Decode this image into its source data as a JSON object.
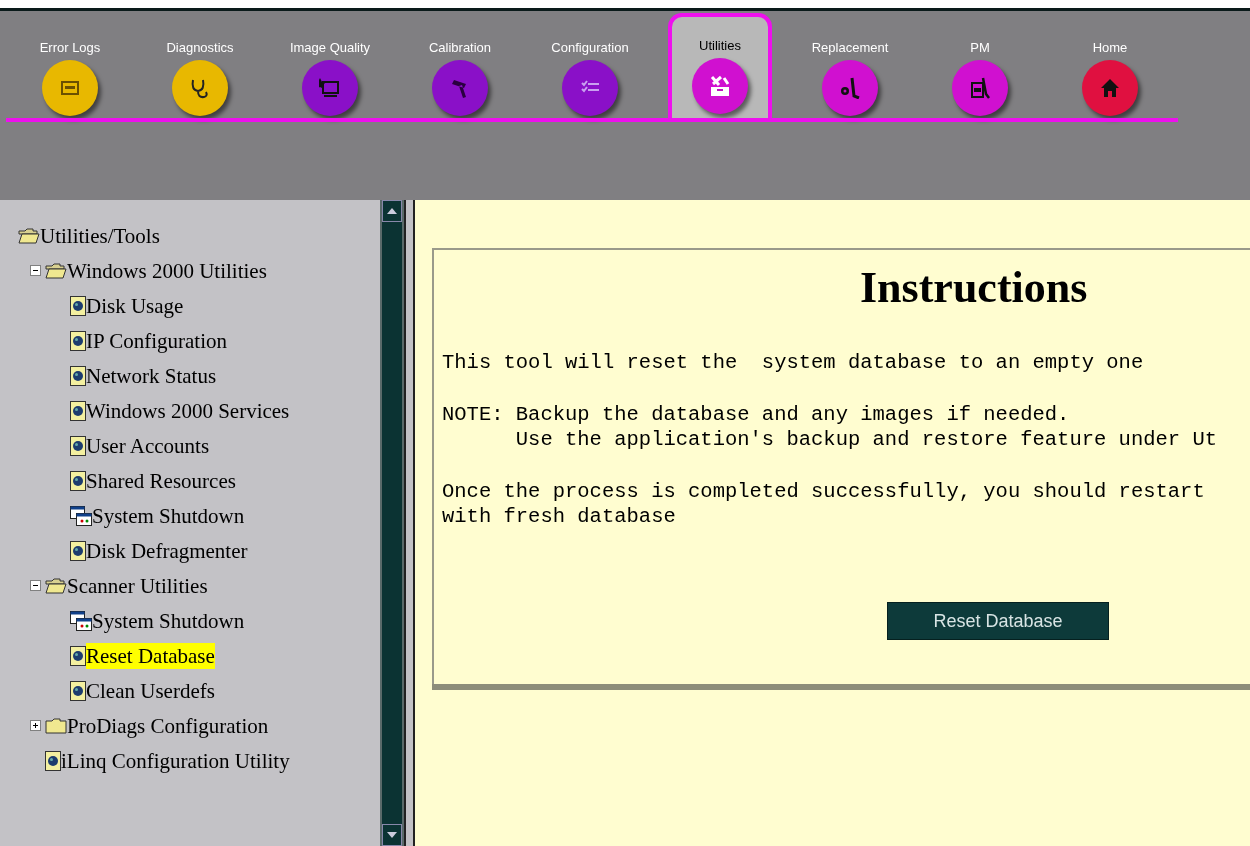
{
  "toolbar": {
    "tabs": [
      {
        "label": "Error Logs",
        "selected": false,
        "color": "#e8b800"
      },
      {
        "label": "Diagnostics",
        "selected": false,
        "color": "#e8b800"
      },
      {
        "label": "Image Quality",
        "selected": false,
        "color": "#8a10c8"
      },
      {
        "label": "Calibration",
        "selected": false,
        "color": "#8a10c8"
      },
      {
        "label": "Configuration",
        "selected": false,
        "color": "#8a10c8"
      },
      {
        "label": "Utilities",
        "selected": true,
        "color": "#d010d0"
      },
      {
        "label": "Replacement",
        "selected": false,
        "color": "#d010d0"
      },
      {
        "label": "PM",
        "selected": false,
        "color": "#d010d0"
      },
      {
        "label": "Home",
        "selected": false,
        "color": "#e01040"
      }
    ]
  },
  "tree": [
    {
      "label": "Utilities/Tools",
      "kind": "folder",
      "expanded": true,
      "selected": false,
      "children": [
        {
          "label": "Windows 2000 Utilities",
          "kind": "folder",
          "expanded": true,
          "selected": false,
          "children": [
            {
              "label": "Disk Usage",
              "kind": "page",
              "selected": false
            },
            {
              "label": "IP Configuration",
              "kind": "page",
              "selected": false
            },
            {
              "label": "Network Status",
              "kind": "page",
              "selected": false
            },
            {
              "label": "Windows 2000 Services",
              "kind": "page",
              "selected": false
            },
            {
              "label": "User Accounts",
              "kind": "page",
              "selected": false
            },
            {
              "label": "Shared Resources",
              "kind": "page",
              "selected": false
            },
            {
              "label": "System Shutdown",
              "kind": "app",
              "selected": false
            },
            {
              "label": "Disk Defragmenter",
              "kind": "page",
              "selected": false
            }
          ]
        },
        {
          "label": "Scanner Utilities",
          "kind": "folder",
          "expanded": true,
          "selected": false,
          "children": [
            {
              "label": "System Shutdown",
              "kind": "app",
              "selected": false
            },
            {
              "label": "Reset Database",
              "kind": "page",
              "selected": true
            },
            {
              "label": "Clean Userdefs",
              "kind": "page",
              "selected": false
            }
          ]
        },
        {
          "label": "ProDiags Configuration",
          "kind": "folder",
          "expanded": false,
          "selected": false
        },
        {
          "label": "iLinq Configuration Utility",
          "kind": "page",
          "selected": false
        }
      ]
    }
  ],
  "instructions": {
    "title": "Instructions",
    "paragraphs": [
      [
        "This tool will reset the  system database to an empty one"
      ],
      [
        "NOTE: Backup the database and any images if needed.",
        "      Use the application's backup and restore feature under Ut"
      ],
      [
        "Once the process is completed successfully, you should restart",
        "with fresh database"
      ]
    ],
    "button": "Reset Database"
  }
}
